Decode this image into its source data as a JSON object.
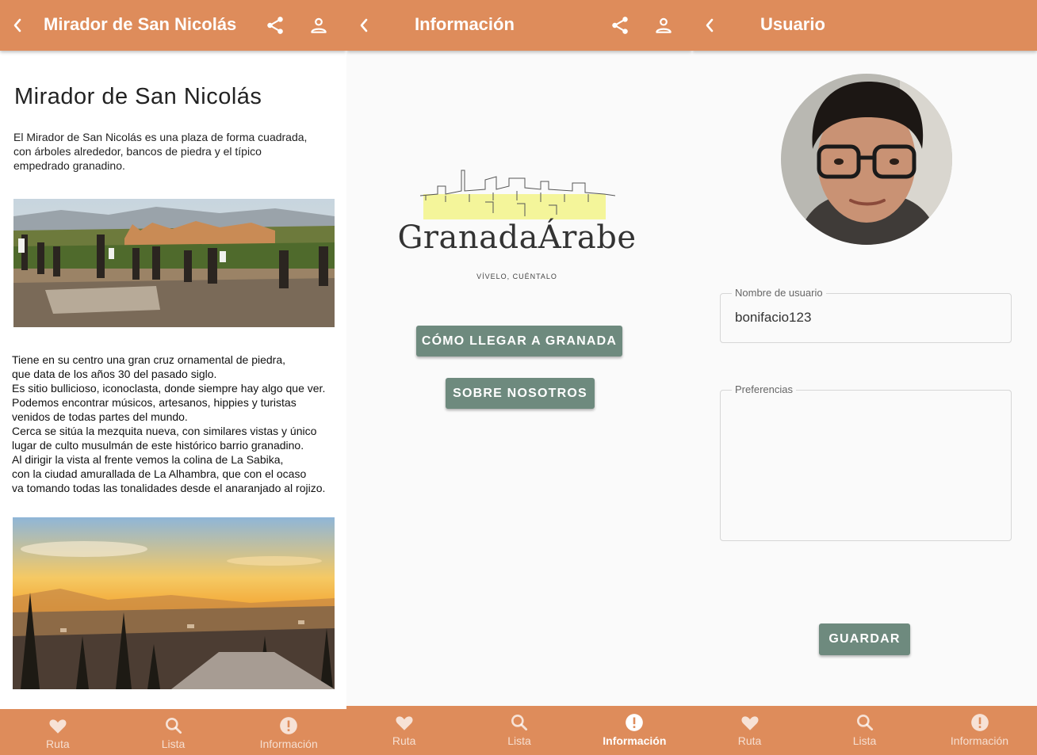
{
  "colors": {
    "accent": "#de8c5b",
    "button": "#6e8a7e"
  },
  "screen1": {
    "appbar": {
      "title": "Mirador de San Nicolás",
      "back_icon": "chevron-left-icon",
      "share_icon": "share-icon",
      "user_icon": "person-outline-icon"
    },
    "heading": "Mirador de San Nicolás",
    "intro": "El Mirador de San Nicolás es una plaza de forma cuadrada,\ncon árboles alrededor, bancos de piedra y el típico\nempedrado granadino.",
    "body": "Tiene en su centro una gran cruz ornamental de piedra,\nque data de los años 30 del pasado siglo.\nEs sitio bullicioso, iconoclasta, donde siempre hay algo que ver.\nPodemos encontrar músicos, artesanos, hippies y turistas\nvenidos de todas partes del mundo.\nCerca se sitúa la mezquita nueva, con similares vistas y único\nlugar de culto musulmán de este histórico barrio granadino.\nAl dirigir la vista al frente vemos la colina de La Sabika,\ncon la ciudad amurallada de La Alhambra, que con el ocaso\nva tomando todas las tonalidades desde el anaranjado al rojizo.",
    "nav": {
      "active": "Información",
      "items": [
        "Ruta",
        "Lista",
        "Información"
      ]
    }
  },
  "screen2": {
    "appbar": {
      "title": "Información"
    },
    "logo": {
      "name": "GranadaÁrabe",
      "tagline": "VÍVELO, CUÉNTALO"
    },
    "buttons": {
      "como_llegar": "CÓMO LLEGAR A GRANADA",
      "sobre_nosotros": "SOBRE NOSOTROS"
    },
    "nav": {
      "active": "Información",
      "items": [
        "Ruta",
        "Lista",
        "Información"
      ]
    }
  },
  "screen3": {
    "appbar": {
      "title": "Usuario"
    },
    "username_field": {
      "label": "Nombre de usuario",
      "value": "bonifacio123"
    },
    "preferences_field": {
      "label": "Preferencias",
      "value": ""
    },
    "save_button": "GUARDAR",
    "nav": {
      "active": "Información",
      "items": [
        "Ruta",
        "Lista",
        "Información"
      ]
    }
  }
}
